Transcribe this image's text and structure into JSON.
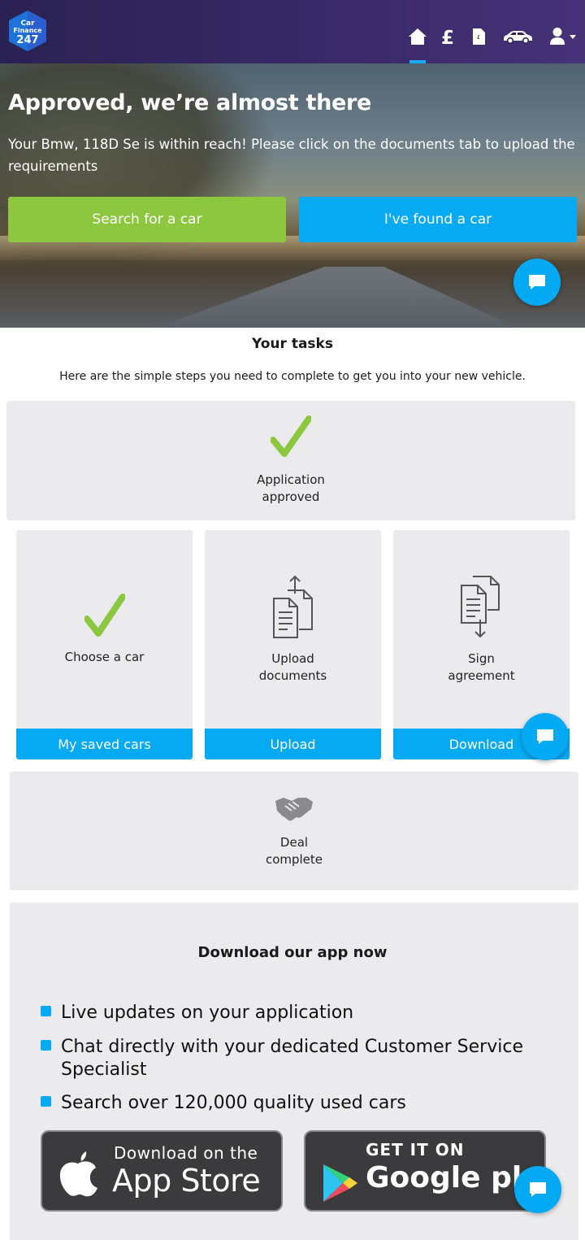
{
  "header": {
    "logo_line1": "Car",
    "logo_line2": "Finance",
    "logo_line3": "247",
    "nav": [
      {
        "icon": "home-icon",
        "active": true
      },
      {
        "icon": "pound-icon",
        "active": false
      },
      {
        "icon": "document-icon",
        "active": false
      },
      {
        "icon": "car-icon",
        "active": false
      },
      {
        "icon": "user-menu-icon",
        "active": false
      }
    ]
  },
  "hero": {
    "title": "Approved, we’re almost there",
    "text": "Your Bmw, 118D Se is within reach! Please click on the documents tab to upload the requirements",
    "search_button": "Search for a car",
    "found_button": "I've found a car"
  },
  "tasks": {
    "title": "Your tasks",
    "subtitle": "Here are the simple steps you need to complete to get you into your new vehicle.",
    "application": {
      "line1": "Application",
      "line2": "approved"
    },
    "choose": {
      "label": "Choose a car",
      "button": "My saved cars"
    },
    "upload": {
      "line1": "Upload",
      "line2": "documents",
      "button": "Upload"
    },
    "sign": {
      "line1": "Sign",
      "line2": "agreement",
      "button": "Download"
    },
    "deal": {
      "line1": "Deal",
      "line2": "complete"
    }
  },
  "app": {
    "title": "Download our app now",
    "bullets": [
      "Live updates on your application",
      "Chat directly with your dedicated Customer Service Specialist",
      "Search over 120,000 quality used cars"
    ],
    "appstore_small": "Download on the",
    "appstore_big": "App Store",
    "google_small": "GET IT ON",
    "google_big": "Google play"
  },
  "colors": {
    "accent_blue": "#05aaf3",
    "accent_green": "#8dc63f",
    "header_purple": "#2e2558"
  }
}
